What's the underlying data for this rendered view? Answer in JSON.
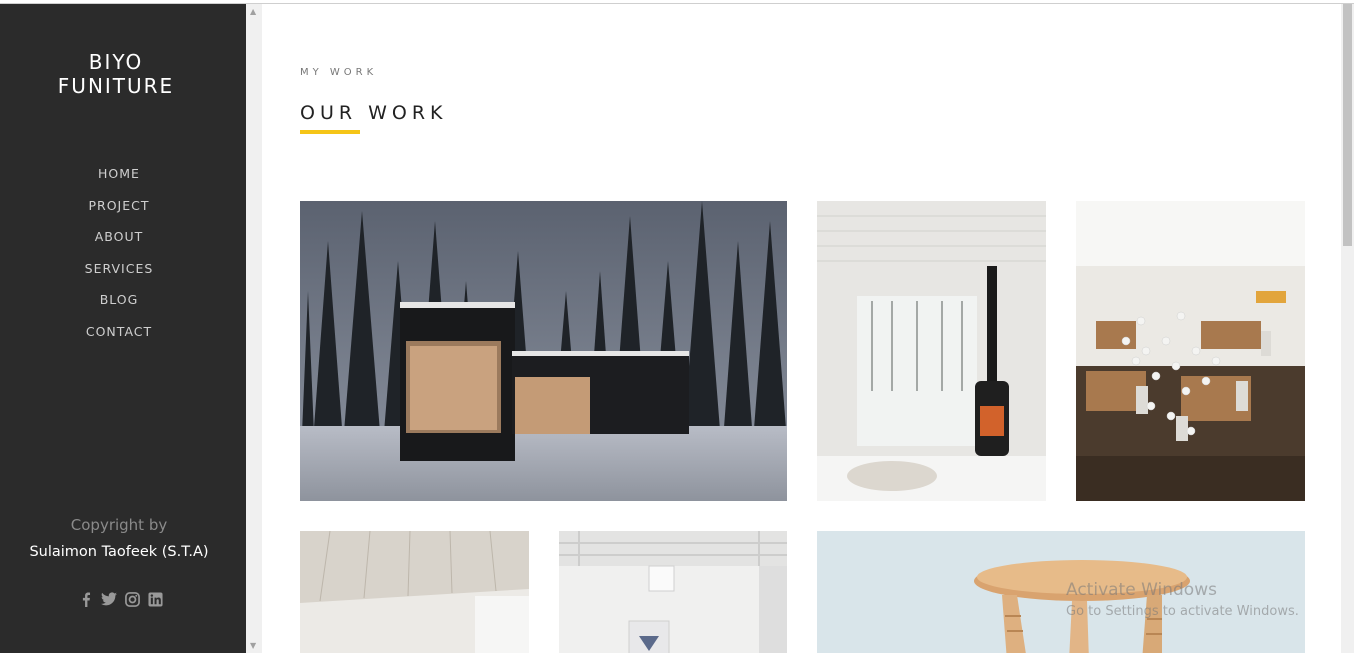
{
  "brand": {
    "line1": "BIYO",
    "line2": "FUNITURE"
  },
  "nav": [
    "HOME",
    "PROJECT",
    "ABOUT",
    "SERVICES",
    "BLOG",
    "CONTACT"
  ],
  "footer": {
    "copyright": "Copyright by",
    "author": "Sulaimon Taofeek (S.T.A)"
  },
  "social_icons": [
    "facebook-icon",
    "twitter-icon",
    "instagram-icon",
    "linkedin-icon"
  ],
  "section": {
    "subtitle": "MY WORK",
    "title": "OUR WORK"
  },
  "accent_color": "#f5c518",
  "watermark": {
    "line1": "Activate Windows",
    "line2": "Go to Settings to activate Windows."
  }
}
